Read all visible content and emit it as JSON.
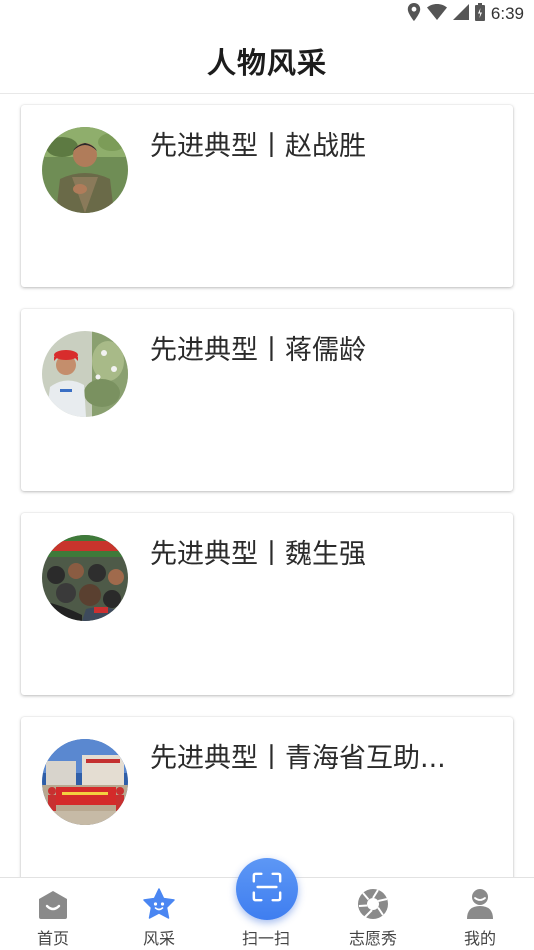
{
  "status_bar": {
    "time": "6:39"
  },
  "header": {
    "title": "人物风采"
  },
  "cards": [
    {
      "title": "先进典型丨赵战胜",
      "avatar": "portrait-man-field"
    },
    {
      "title": "先进典型丨蒋儒龄",
      "avatar": "portrait-man-orchard"
    },
    {
      "title": "先进典型丨魏生强",
      "avatar": "crowd-meeting"
    },
    {
      "title": "先进典型丨青海省互助...",
      "avatar": "group-with-banner"
    }
  ],
  "bottom_nav": {
    "items": [
      {
        "label": "首页",
        "icon": "home-icon"
      },
      {
        "label": "风采",
        "icon": "star-icon"
      },
      {
        "label": "扫一扫",
        "icon": "scan-icon"
      },
      {
        "label": "志愿秀",
        "icon": "aperture-icon"
      },
      {
        "label": "我的",
        "icon": "person-icon"
      }
    ],
    "active_index": 1
  },
  "colors": {
    "accent": "#4a86f2",
    "icon_gray": "#8a8a8a"
  }
}
